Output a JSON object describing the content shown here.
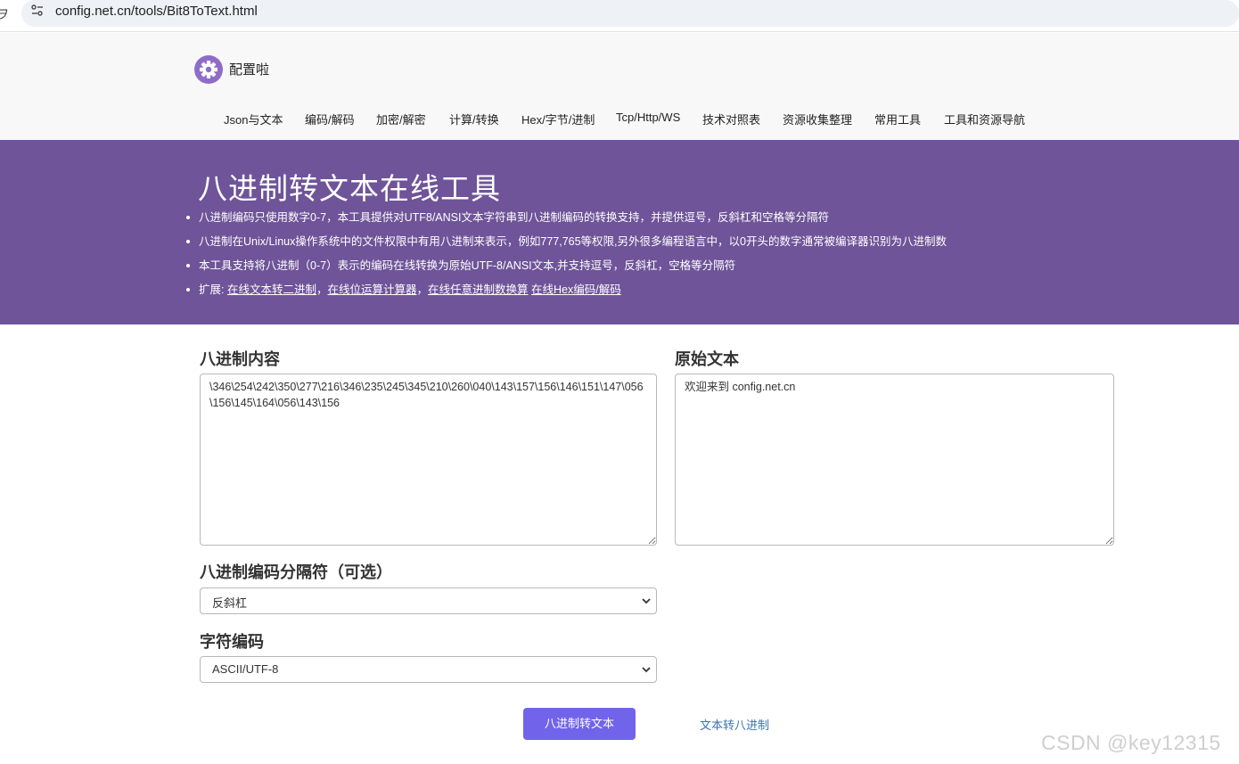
{
  "browser": {
    "url": "config.net.cn/tools/Bit8ToText.html"
  },
  "site": {
    "name": "配置啦"
  },
  "nav": [
    {
      "label": "Json与文本"
    },
    {
      "label": "编码/解码"
    },
    {
      "label": "加密/解密"
    },
    {
      "label": "计算/转换"
    },
    {
      "label": "Hex/字节/进制"
    },
    {
      "label": "Tcp/Http/WS"
    },
    {
      "label": "技术对照表"
    },
    {
      "label": "资源收集整理"
    },
    {
      "label": "常用工具"
    },
    {
      "label": "工具和资源导航"
    }
  ],
  "banner": {
    "title": "八进制转文本在线工具",
    "bullets": [
      "八进制编码只使用数字0-7，本工具提供对UTF8/ANSI文本字符串到八进制编码的转换支持，并提供逗号，反斜杠和空格等分隔符",
      "八进制在Unix/Linux操作系统中的文件权限中有用八进制来表示，例如777,765等权限,另外很多编程语言中，以0开头的数字通常被编译器识别为八进制数",
      "本工具支持将八进制（0-7）表示的编码在线转换为原始UTF-8/ANSI文本,并支持逗号，反斜杠，空格等分隔符"
    ],
    "extend_prefix": "扩展: ",
    "extend_links": [
      "在线文本转二进制",
      "在线位运算计算器",
      "在线任意进制数换算",
      "在线Hex编码/解码"
    ],
    "extend_sep": "，"
  },
  "form": {
    "octal_label": "八进制内容",
    "octal_value": "\\346\\254\\242\\350\\277\\216\\346\\235\\245\\345\\210\\260\\040\\143\\157\\156\\146\\151\\147\\056\\156\\145\\164\\056\\143\\156",
    "text_label": "原始文本",
    "text_value": "欢迎来到 config.net.cn",
    "separator_label": "八进制编码分隔符（可选）",
    "separator_value": "反斜杠",
    "encoding_label": "字符编码",
    "encoding_value": "ASCII/UTF-8"
  },
  "actions": {
    "convert_label": "八进制转文本",
    "reverse_label": "文本转八进制"
  },
  "watermark": "CSDN @key12315",
  "colors": {
    "banner": "#6f5499",
    "primary_button": "#7164ea",
    "link": "#3a74b4",
    "logo": "#8f6cc7"
  }
}
